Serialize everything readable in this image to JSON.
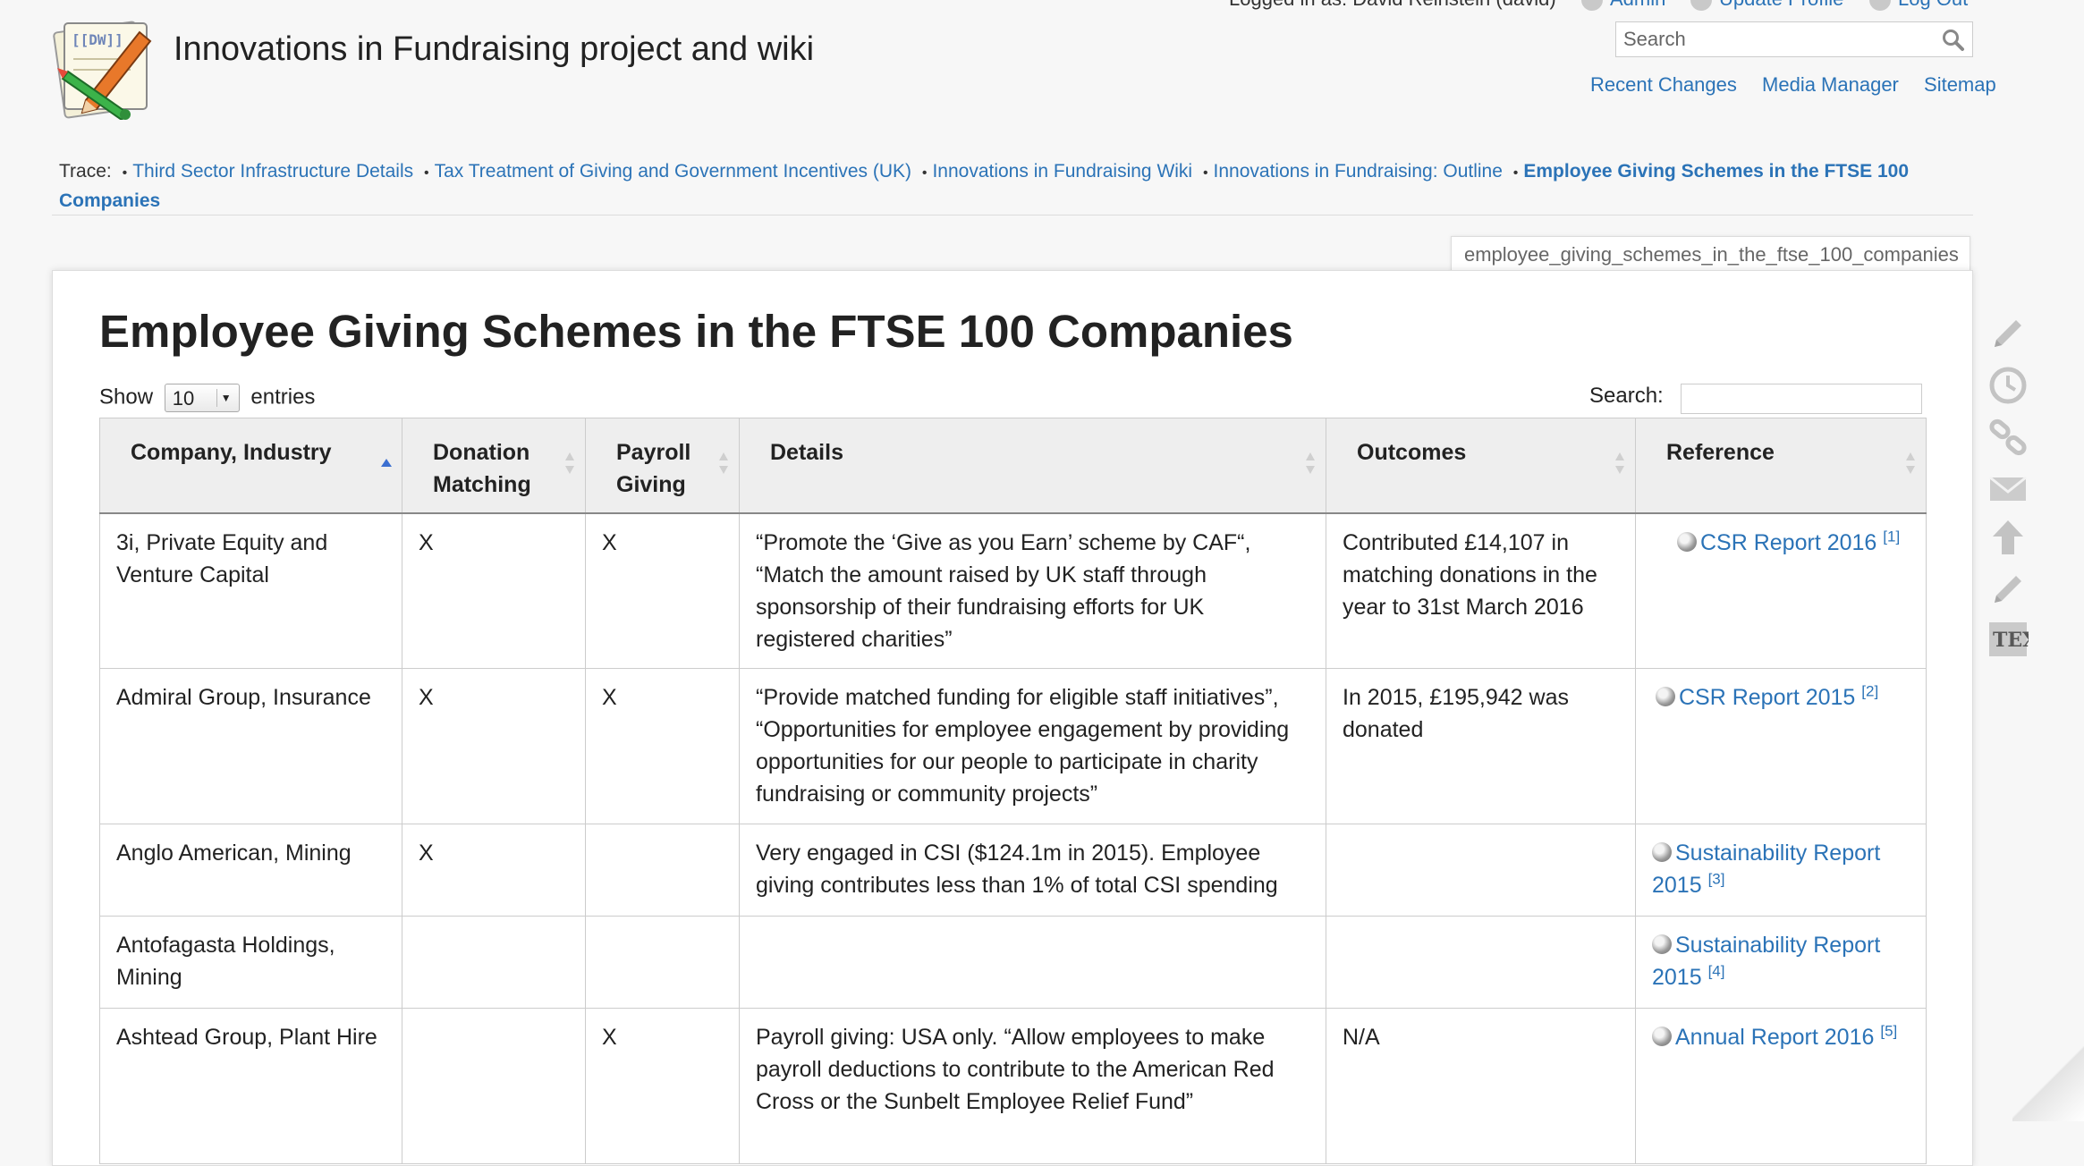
{
  "site": {
    "title": "Innovations in Fundraising project and wiki"
  },
  "user_tools": {
    "logged_in": "Logged in as: David Reinstein (david)",
    "admin": "Admin",
    "update_profile": "Update Profile",
    "logout": "Log Out"
  },
  "search": {
    "placeholder": "Search"
  },
  "site_tools": {
    "recent_changes": "Recent Changes",
    "media_manager": "Media Manager",
    "sitemap": "Sitemap"
  },
  "breadcrumbs": {
    "label": "Trace:",
    "items": [
      "Third Sector Infrastructure Details",
      "Tax Treatment of Giving and Government Incentives (UK)",
      "Innovations in Fundraising Wiki",
      "Innovations in Fundraising: Outline",
      "Employee Giving Schemes in the FTSE 100 Companies"
    ]
  },
  "page": {
    "id": "employee_giving_schemes_in_the_ftse_100_companies",
    "title": "Employee Giving Schemes in the FTSE 100 Companies"
  },
  "table_controls": {
    "show": "Show",
    "entries_value": "10",
    "entries": "entries",
    "search_label": "Search:"
  },
  "table": {
    "headers": [
      "Company, Industry",
      "Donation Matching",
      "Payroll Giving",
      "Details",
      "Outcomes",
      "Reference"
    ],
    "rows": [
      {
        "company": "3i, Private Equity and Venture Capital",
        "matching": "X",
        "payroll": "X",
        "details": "“Promote the ‘Give as you Earn’ scheme by CAF“, “Match the amount raised by UK staff through sponsorship of their fundraising efforts for UK registered charities”",
        "outcomes": "Contributed £14,107 in matching donations in the year to 31st March 2016",
        "ref_text": "CSR Report 2016",
        "ref_note": "[1]"
      },
      {
        "company": "Admiral Group, Insurance",
        "matching": "X",
        "payroll": "X",
        "details": "“Provide matched funding for eligible staff initiatives”, “Opportunities for employee engagement by providing opportunities for our people to participate in charity fundraising or community projects”",
        "outcomes": "In 2015, £195,942 was donated",
        "ref_text": "CSR Report 2015",
        "ref_note": "[2]"
      },
      {
        "company": "Anglo American, Mining",
        "matching": "X",
        "payroll": "",
        "details": "Very engaged in CSI ($124.1m in 2015). Employee giving contributes less than 1% of total CSI spending",
        "outcomes": "",
        "ref_text": "Sustainability Report 2015",
        "ref_note": "[3]"
      },
      {
        "company": "Antofagasta Holdings, Mining",
        "matching": "",
        "payroll": "",
        "details": "",
        "outcomes": "",
        "ref_text": "Sustainability Report 2015",
        "ref_note": "[4]"
      },
      {
        "company": "Ashtead Group, Plant Hire",
        "matching": "",
        "payroll": "X",
        "details": "Payroll giving: USA only. “Allow employees to make payroll deductions to contribute to the American Red Cross or the Sunbelt Employee Relief Fund”",
        "outcomes": "N/A",
        "ref_text": "Annual Report 2016",
        "ref_note": "[5]"
      }
    ]
  },
  "page_tools": [
    "edit-icon",
    "revisions-icon",
    "backlinks-icon",
    "email-icon",
    "back-to-top-icon",
    "edit-section-icon",
    "tex-icon"
  ],
  "colors": {
    "link": "#2b73b7",
    "header_bg": "#eeeeee",
    "page_bg": "#f7f7f7"
  }
}
